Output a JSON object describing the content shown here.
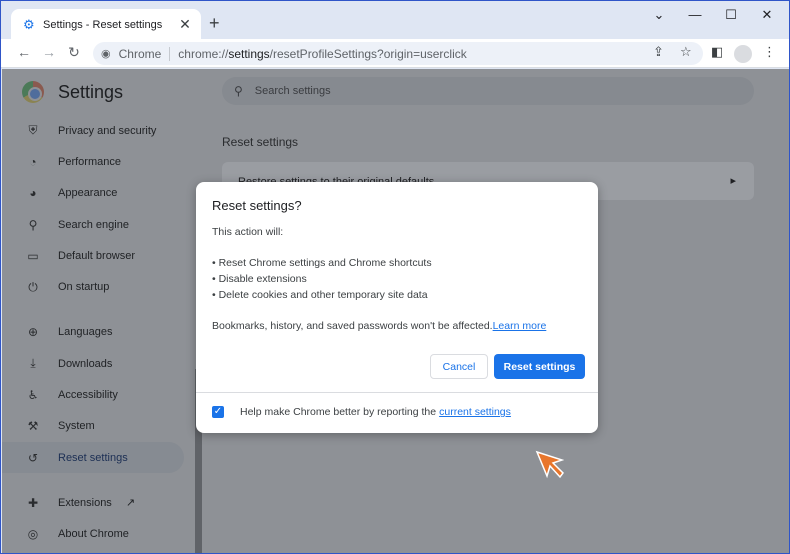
{
  "tab": {
    "title": "Settings - Reset settings",
    "close": "✕",
    "new_tab": "+"
  },
  "window_controls": {
    "dropdown": "⌄",
    "minimize": "—",
    "maximize": "☐",
    "close": "✕"
  },
  "toolbar": {
    "chip": "Chrome",
    "url_prefix": "chrome://",
    "url_host": "settings",
    "url_path": "/resetProfileSettings?origin=userclick"
  },
  "sidebar": {
    "title": "Settings",
    "items": [
      {
        "label": "Privacy and security",
        "icon": "shield-icon"
      },
      {
        "label": "Performance",
        "icon": "speedometer-icon"
      },
      {
        "label": "Appearance",
        "icon": "palette-icon"
      },
      {
        "label": "Search engine",
        "icon": "search-icon"
      },
      {
        "label": "Default browser",
        "icon": "browser-icon"
      },
      {
        "label": "On startup",
        "icon": "power-icon"
      },
      {
        "label": "Languages",
        "icon": "globe-icon"
      },
      {
        "label": "Downloads",
        "icon": "download-icon"
      },
      {
        "label": "Accessibility",
        "icon": "accessibility-icon"
      },
      {
        "label": "System",
        "icon": "wrench-icon"
      },
      {
        "label": "Reset settings",
        "icon": "history-icon",
        "active": true
      },
      {
        "label": "Extensions",
        "icon": "puzzle-icon"
      },
      {
        "label": "About Chrome",
        "icon": "chrome-icon"
      }
    ]
  },
  "main": {
    "search_placeholder": "Search settings",
    "section_title": "Reset settings",
    "card_label": "Restore settings to their original defaults"
  },
  "dialog": {
    "title": "Reset settings?",
    "intro": "This action will:",
    "bullets": [
      "• Reset Chrome settings and Chrome shortcuts",
      "• Disable extensions",
      "• Delete cookies and other temporary site data"
    ],
    "note": "Bookmarks, history, and saved passwords won't be affected.",
    "learn_more": "Learn more",
    "cancel_label": "Cancel",
    "reset_label": "Reset settings",
    "footer_text": "Help make Chrome better by reporting the",
    "footer_link": "current settings",
    "checkbox_checked": true
  },
  "colors": {
    "accent": "#1a73e8",
    "cursor": "#e8762c"
  }
}
